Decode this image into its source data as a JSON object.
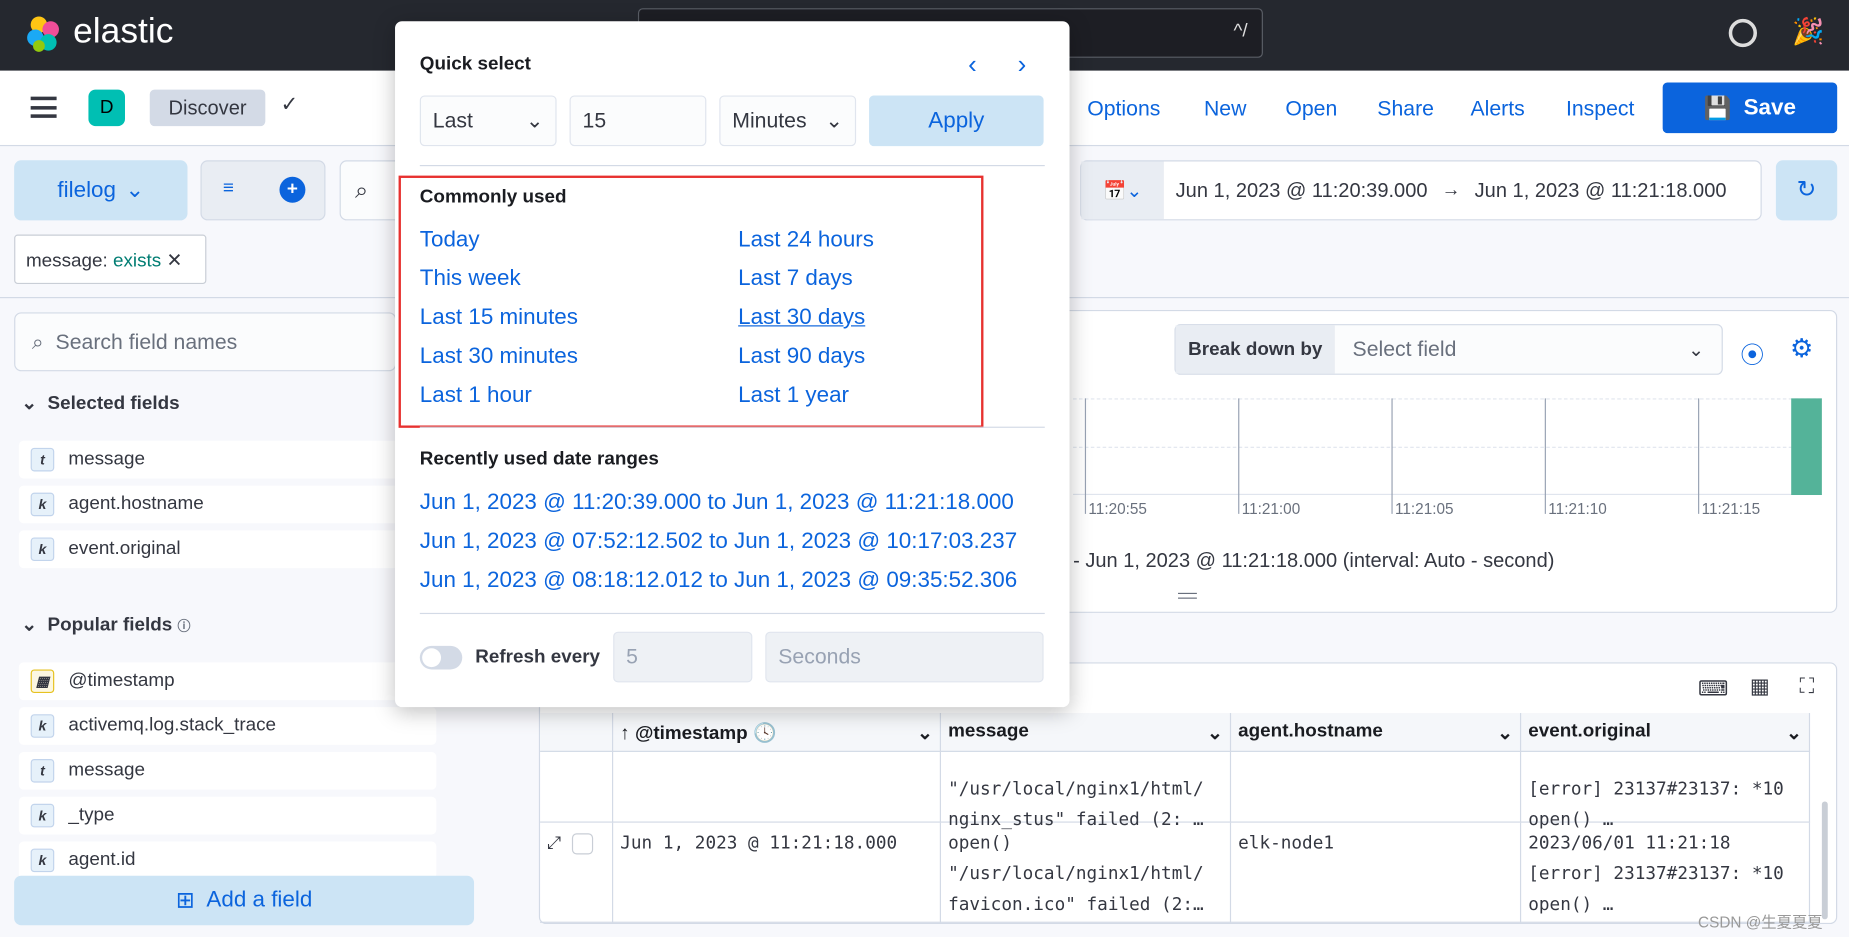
{
  "header": {
    "brand": "elastic",
    "search_shortcut": "^/"
  },
  "appbar": {
    "space_initial": "D",
    "breadcrumb": "Discover",
    "menu": [
      "Options",
      "New",
      "Open",
      "Share",
      "Alerts",
      "Inspect"
    ],
    "save_label": "Save"
  },
  "query": {
    "data_view": "filelog",
    "filter_pill": {
      "field": "message:",
      "value": "exists"
    },
    "start": "Jun 1, 2023 @ 11:20:39.000",
    "end": "Jun 1, 2023 @ 11:21:18.000"
  },
  "quick_select": {
    "title": "Quick select",
    "direction": "Last",
    "value": "15",
    "unit": "Minutes",
    "apply": "Apply",
    "commonly_used_title": "Commonly used",
    "commonly_used": [
      "Today",
      "This week",
      "Last 15 minutes",
      "Last 30 minutes",
      "Last 1 hour",
      "Last 24 hours",
      "Last 7 days",
      "Last 30 days",
      "Last 90 days",
      "Last 1 year"
    ],
    "recent_title": "Recently used date ranges",
    "recent": [
      "Jun 1, 2023 @ 11:20:39.000 to Jun 1, 2023 @ 11:21:18.000",
      "Jun 1, 2023 @ 07:52:12.502 to Jun 1, 2023 @ 10:17:03.237",
      "Jun 1, 2023 @ 08:18:12.012 to Jun 1, 2023 @ 09:35:52.306"
    ],
    "refresh_label": "Refresh every",
    "refresh_value": "5",
    "refresh_unit": "Seconds",
    "refresh_on": false
  },
  "sidebar": {
    "search_placeholder": "Search field names",
    "selected_title": "Selected fields",
    "selected": [
      {
        "type": "t",
        "name": "message"
      },
      {
        "type": "k",
        "name": "agent.hostname"
      },
      {
        "type": "k",
        "name": "event.original"
      }
    ],
    "popular_title": "Popular fields",
    "popular": [
      {
        "type": "date",
        "name": "@timestamp"
      },
      {
        "type": "k",
        "name": "activemq.log.stack_trace"
      },
      {
        "type": "t",
        "name": "message"
      },
      {
        "type": "k",
        "name": "_type"
      },
      {
        "type": "k",
        "name": "agent.id"
      }
    ],
    "add_field": "Add a field"
  },
  "histogram": {
    "breakdown_label": "Break down by",
    "breakdown_placeholder": "Select field",
    "ticks": [
      "11:20:55",
      "11:21:00",
      "11:21:05",
      "11:21:10",
      "11:21:15"
    ],
    "interval_text": "- Jun 1, 2023 @ 11:21:18.000 (interval: Auto - second)",
    "bar_color": "#54b399"
  },
  "table": {
    "columns": [
      "@timestamp",
      "message",
      "agent.hostname",
      "event.original"
    ],
    "rows": [
      {
        "timestamp": "",
        "message": [
          "\"/usr/local/nginx1/html/",
          "nginx_stus\" failed (2: …"
        ],
        "hostname": "",
        "original": [
          "[error] 23137#23137: *10",
          "open() …"
        ]
      },
      {
        "timestamp": "Jun 1, 2023 @ 11:21:18.000",
        "message": [
          "open()",
          "\"/usr/local/nginx1/html/",
          "favicon.ico\" failed (2:…"
        ],
        "hostname": "elk-node1",
        "original": [
          "2023/06/01 11:21:18",
          "[error] 23137#23137: *10",
          "open() …"
        ]
      }
    ]
  },
  "watermark": "CSDN @生夏夏夏"
}
